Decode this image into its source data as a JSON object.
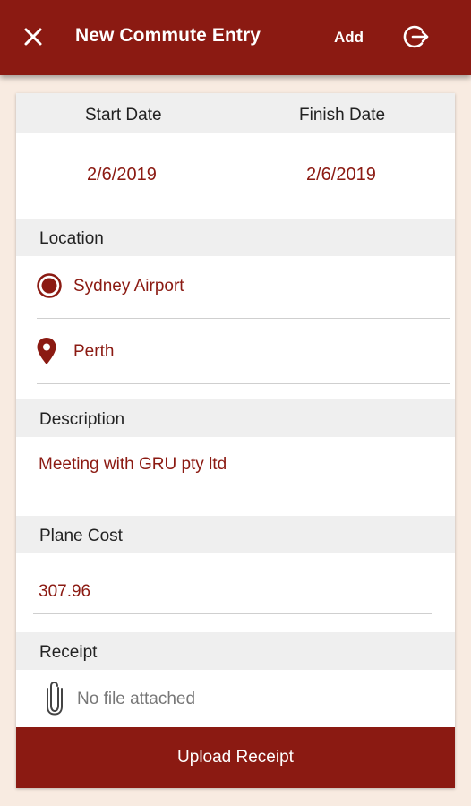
{
  "topbar": {
    "title": "New Commute Entry",
    "add_label": "Add",
    "close_icon": "close-icon",
    "logout_icon": "logout-icon",
    "color": "#8b1a12"
  },
  "dates": {
    "start_label": "Start Date",
    "finish_label": "Finish Date",
    "start_value": "2/6/2019",
    "finish_value": "2/6/2019"
  },
  "location": {
    "label": "Location",
    "origin": "Sydney Airport",
    "destination": "Perth",
    "origin_icon": "radio-origin-icon",
    "destination_icon": "map-pin-icon"
  },
  "description": {
    "label": "Description",
    "value": "Meeting with GRU pty ltd"
  },
  "cost": {
    "label": "Plane Cost",
    "value": "307.96"
  },
  "receipt": {
    "label": "Receipt",
    "status": "No file attached",
    "icon": "paperclip-icon",
    "upload_label": "Upload Receipt"
  }
}
